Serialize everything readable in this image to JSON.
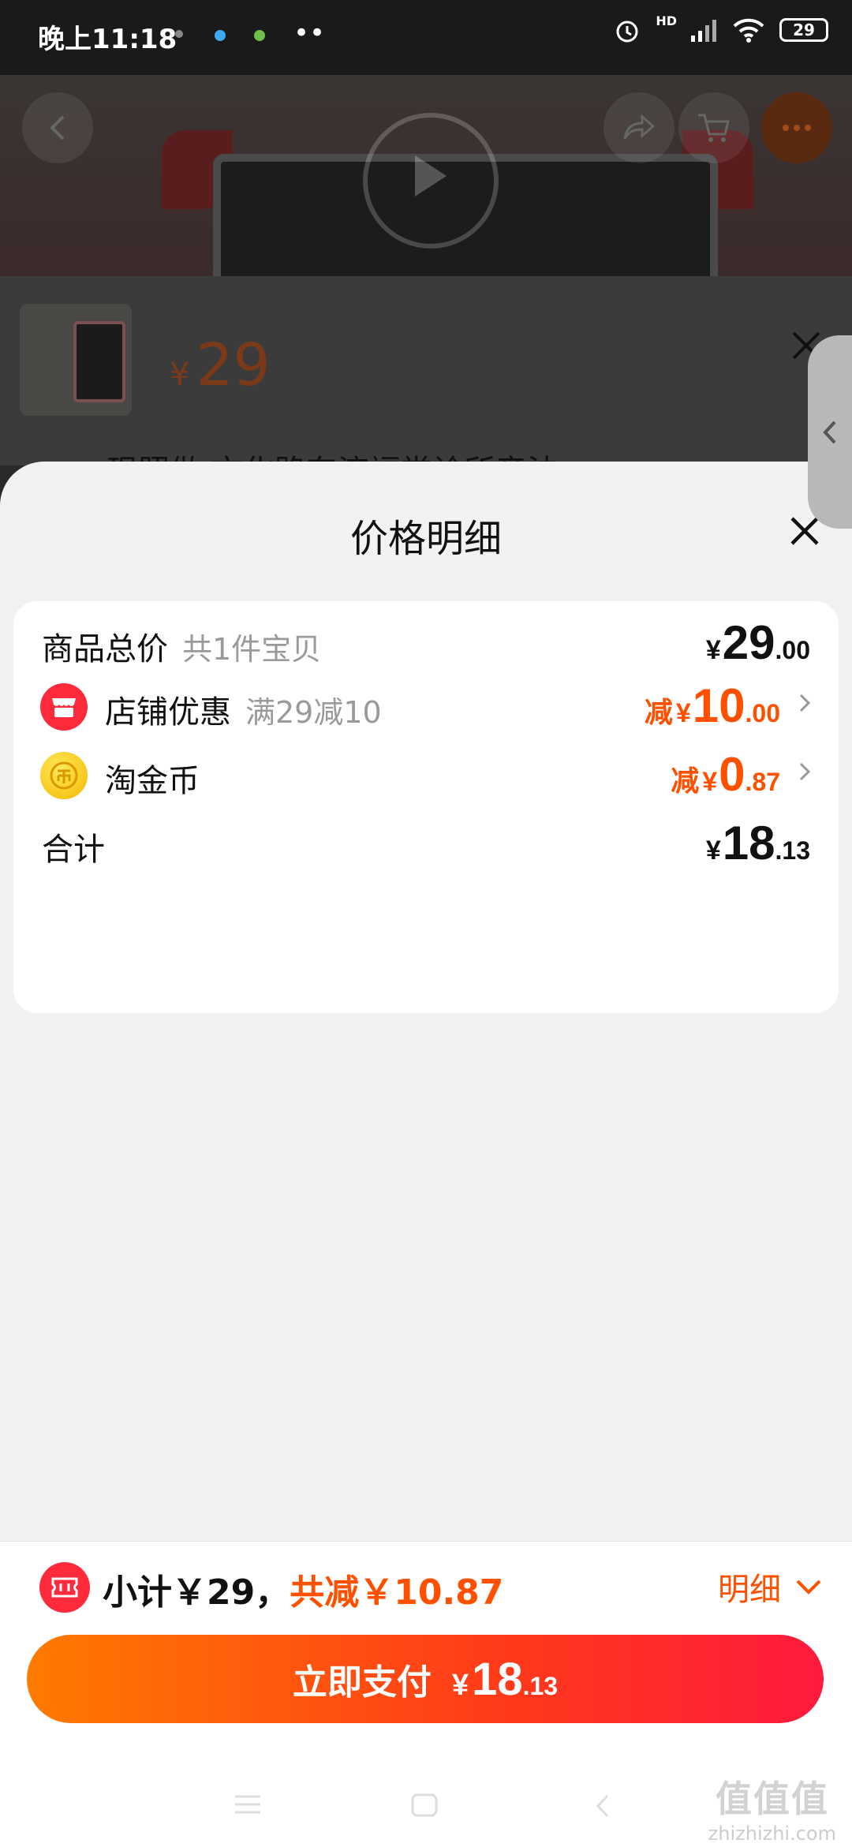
{
  "status_bar": {
    "time": "晚上11:18",
    "network": "HD",
    "battery": "29"
  },
  "product": {
    "price_symbol": "¥",
    "price": "29",
    "title_fragment": "现照做 文化路东济福堂诊所音法"
  },
  "sheet": {
    "title": "价格明细",
    "rows": [
      {
        "label": "商品总价",
        "sub": "共1件宝贝",
        "prefix": "",
        "yen": "¥",
        "int": "29",
        "dec": ".00"
      },
      {
        "label": "店铺优惠",
        "sub": "满29减10",
        "prefix": "减",
        "yen": "¥",
        "int": "10",
        "dec": ".00"
      },
      {
        "label": "淘金币",
        "sub": "",
        "prefix": "减",
        "yen": "¥",
        "int": "0",
        "dec": ".87"
      },
      {
        "label": "合计",
        "sub": "",
        "prefix": "",
        "yen": "¥",
        "int": "18",
        "dec": ".13"
      }
    ]
  },
  "bottom": {
    "subtotal_text": "小计￥29，",
    "discount_text": "共减￥10.87",
    "detail_label": "明细",
    "pay_label": "立即支付",
    "pay_yen": "¥",
    "pay_int": "18",
    "pay_dec": ".13"
  },
  "watermark": {
    "logo": "值值值",
    "site": "zhizhizhi.com"
  },
  "colors": {
    "accent": "#ff5000",
    "pay_gradient_start": "#ff7a00",
    "pay_gradient_end": "#ff1a3e",
    "shop_icon": "#ff2a3c",
    "coin_icon": "#ffcc00"
  }
}
